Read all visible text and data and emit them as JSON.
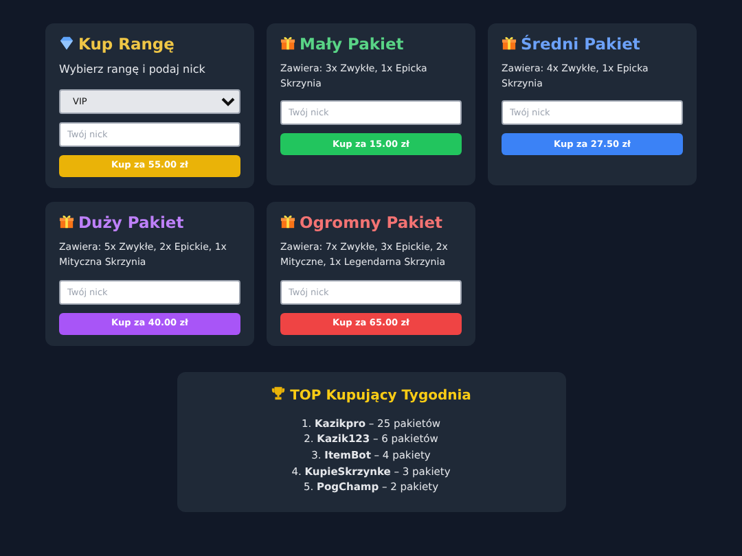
{
  "cards": [
    {
      "kind": "rank",
      "title": "Kup Rangę",
      "color": "#eab308",
      "description": "Wybierz rangę i podaj nick",
      "select_value": "VIP",
      "placeholder": "Twój nick",
      "button": "Kup za 55.00 zł"
    },
    {
      "kind": "package",
      "title": "Mały Pakiet",
      "color": "#22c55e",
      "description": "Zawiera: 3x Zwykłe, 1x Epicka Skrzynia",
      "placeholder": "Twój nick",
      "button": "Kup za 15.00 zł"
    },
    {
      "kind": "package",
      "title": "Średni Pakiet",
      "color": "#3b82f6",
      "description": "Zawiera: 4x Zwykłe, 1x Epicka Skrzynia",
      "placeholder": "Twój nick",
      "button": "Kup za 27.50 zł"
    },
    {
      "kind": "package",
      "title": "Duży Pakiet",
      "color": "#a855f7",
      "description": "Zawiera: 5x Zwykłe, 2x Epickie, 1x Mityczna Skrzynia",
      "placeholder": "Twój nick",
      "button": "Kup za 40.00 zł"
    },
    {
      "kind": "package",
      "title": "Ogromny Pakiet",
      "color": "#ef4444",
      "description": "Zawiera: 7x Zwykłe, 3x Epickie, 2x Mityczne, 1x Legendarna Skrzynia",
      "placeholder": "Twój nick",
      "button": "Kup za 65.00 zł"
    }
  ],
  "top_buyers": {
    "title": "TOP Kupujący Tygodnia",
    "entries": [
      "1. **Kazikpro** – 25 pakietów",
      "2. **Kazik123** – 6 pakietów",
      "3. **ItemBot** – 4 pakiety",
      "4. **KupieSkrzynke** – 3 pakiety",
      "5. **PogChamp** – 2 pakiety"
    ]
  }
}
